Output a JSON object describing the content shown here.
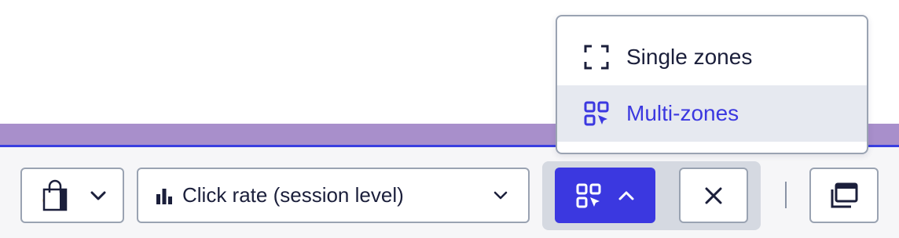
{
  "segment_picker": {
    "icon": "shopping-bag-icon",
    "caret": "chevron-down-icon"
  },
  "metric_select": {
    "icon": "bar-chart-icon",
    "label": "Click rate (session level)",
    "caret": "chevron-down-icon"
  },
  "zone_mode_button": {
    "icon": "multi-zones-icon",
    "caret": "chevron-up-icon",
    "state": "open"
  },
  "close_button": {
    "icon": "close-icon"
  },
  "window_button": {
    "icon": "window-stack-icon"
  },
  "zone_menu": {
    "options": [
      {
        "label": "Single zones",
        "icon": "single-zone-icon",
        "selected": false
      },
      {
        "label": "Multi-zones",
        "icon": "multi-zones-icon",
        "selected": true
      }
    ]
  },
  "colors": {
    "accent": "#3b38e0",
    "text": "#1b1f3b",
    "purple_band": "#a88fcb",
    "blue_line": "#3a3fe0",
    "border": "#9aa3b2",
    "menu_highlight": "#e6e9f0",
    "toggle_group_bg": "#d5d9e1"
  }
}
